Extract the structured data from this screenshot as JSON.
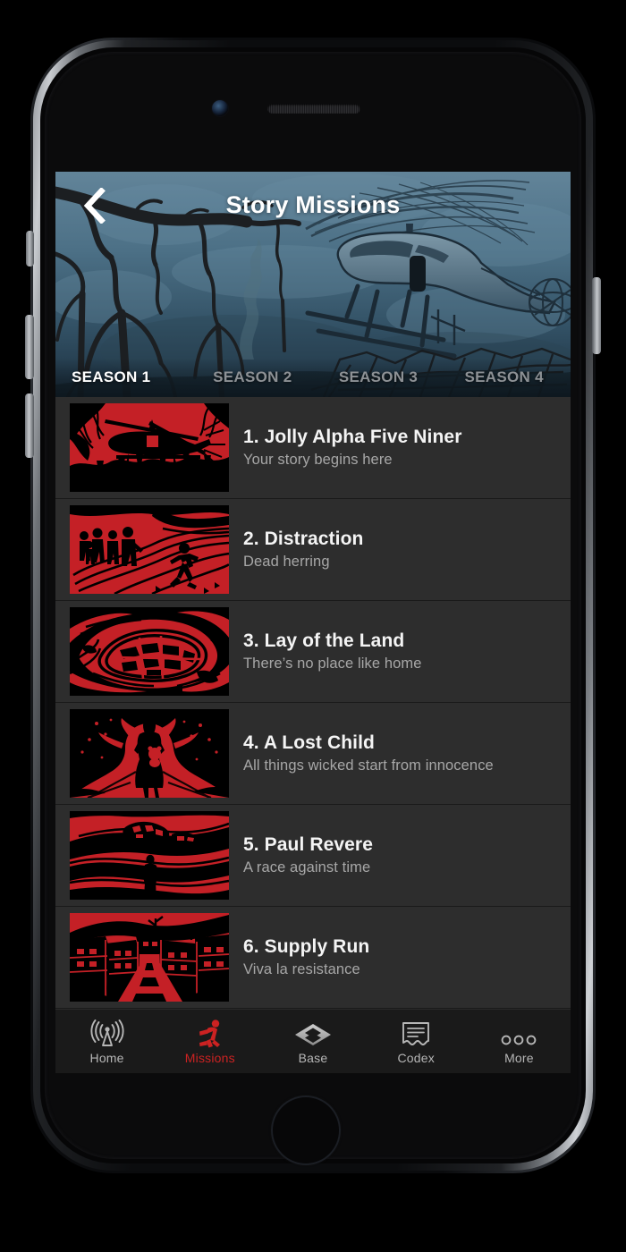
{
  "app": {
    "accent_red": "#cc2222",
    "screen_bg": "#1b1b1b",
    "row_bg": "#2d2d2d"
  },
  "header": {
    "title": "Story Missions",
    "back_icon": "chevron-left-icon",
    "artwork": "helicopter-over-dead-forest"
  },
  "season_tabs": [
    {
      "label": "SEASON 1",
      "active": true
    },
    {
      "label": "SEASON 2",
      "active": false
    },
    {
      "label": "SEASON 3",
      "active": false
    },
    {
      "label": "SEASON 4",
      "active": false
    }
  ],
  "missions": [
    {
      "title": "1. Jolly Alpha Five Niner",
      "subtitle": "Your story begins here",
      "art": "helicopter"
    },
    {
      "title": "2. Distraction",
      "subtitle": "Dead herring",
      "art": "crowd-runner"
    },
    {
      "title": "3. Lay of the Land",
      "subtitle": "There’s no place like home",
      "art": "township-map"
    },
    {
      "title": "4. A Lost Child",
      "subtitle": "All things wicked start from innocence",
      "art": "child-on-road"
    },
    {
      "title": "5. Paul Revere",
      "subtitle": "A race against time",
      "art": "runner-landscape"
    },
    {
      "title": "6. Supply Run",
      "subtitle": "Viva la resistance",
      "art": "town-street"
    }
  ],
  "tabbar": [
    {
      "label": "Home",
      "icon": "radio-tower-icon",
      "active": false
    },
    {
      "label": "Missions",
      "icon": "running-figure-icon",
      "active": true
    },
    {
      "label": "Base",
      "icon": "diamond-base-icon",
      "active": false
    },
    {
      "label": "Codex",
      "icon": "document-icon",
      "active": false
    },
    {
      "label": "More",
      "icon": "three-dots-icon",
      "active": false
    }
  ]
}
